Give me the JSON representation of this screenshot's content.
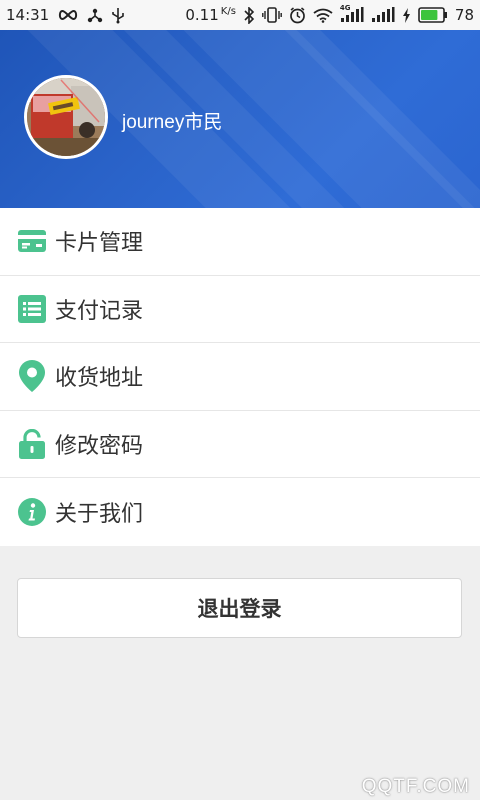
{
  "status_bar": {
    "time": "14:31",
    "net_speed": "0.11",
    "net_speed_unit": "K/s",
    "network_type": "4G",
    "battery": "78",
    "battery_color": "#3cc43c"
  },
  "profile": {
    "username": "journey市民",
    "header_color": "#2a63c9"
  },
  "menu": {
    "items": [
      {
        "label": "卡片管理",
        "icon": "card-icon"
      },
      {
        "label": "支付记录",
        "icon": "list-icon"
      },
      {
        "label": "收货地址",
        "icon": "location-pin-icon"
      },
      {
        "label": "修改密码",
        "icon": "lock-icon"
      },
      {
        "label": "关于我们",
        "icon": "info-icon"
      }
    ],
    "icon_color": "#4cc38f"
  },
  "logout": {
    "label": "退出登录"
  },
  "watermark": {
    "text": "QQTF.COM"
  }
}
